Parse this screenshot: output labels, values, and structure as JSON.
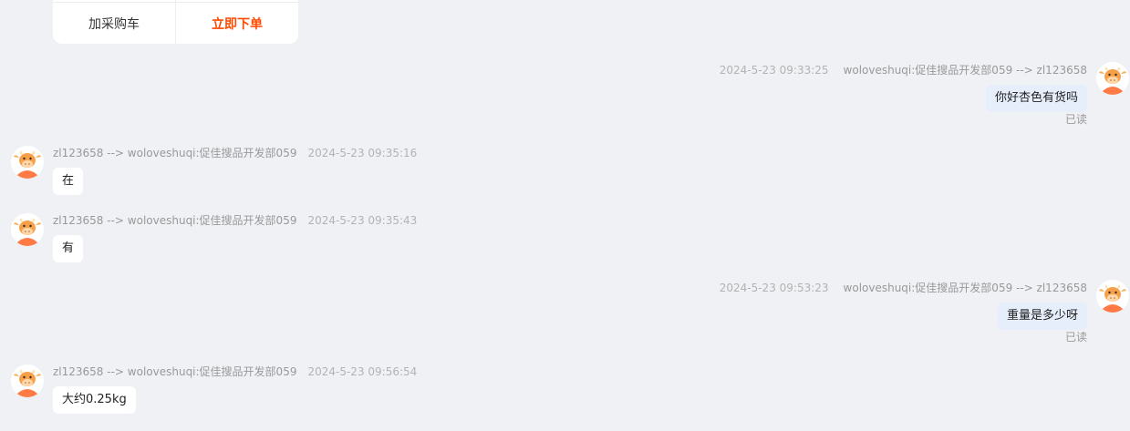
{
  "product_card": {
    "add_to_cart_label": "加采购车",
    "order_now_label": "立即下单"
  },
  "messages": [
    {
      "time": "2024-5-23 09:33:25",
      "route": "woloveshuqi:促佳搜品开发部059 --> zl123658",
      "text": "你好杏色有货吗",
      "status": "已读"
    },
    {
      "route": "zl123658 --> woloveshuqi:促佳搜品开发部059",
      "time": "2024-5-23 09:35:16",
      "text": "在"
    },
    {
      "route": "zl123658 --> woloveshuqi:促佳搜品开发部059",
      "time": "2024-5-23 09:35:43",
      "text": "有"
    },
    {
      "time": "2024-5-23 09:53:23",
      "route": "woloveshuqi:促佳搜品开发部059 --> zl123658",
      "text": "重量是多少呀",
      "status": "已读"
    },
    {
      "route": "zl123658 --> woloveshuqi:促佳搜品开发部059",
      "time": "2024-5-23 09:56:54",
      "text": "大约0.25kg"
    }
  ],
  "colors": {
    "background": "#f0f1f5",
    "outgoing_bubble": "#e6edfb",
    "incoming_bubble": "#ffffff",
    "primary_action": "#ff4a00",
    "avatar_accent": "#ff7a45"
  },
  "icons": {
    "avatar": "cartoon-ox-avatar-icon"
  }
}
